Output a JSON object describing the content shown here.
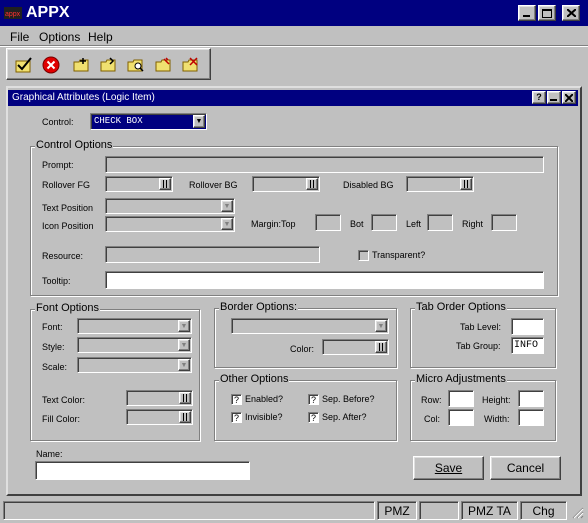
{
  "app": {
    "title": "APPX"
  },
  "menu": {
    "items": [
      "File",
      "Options",
      "Help"
    ]
  },
  "toolbar": {
    "icons": [
      "save-check",
      "cancel",
      "new-folder",
      "open-folder",
      "find-folder",
      "edit-folder",
      "delete-folder"
    ]
  },
  "dialog": {
    "title": "Graphical Attributes (Logic Item)",
    "control_label": "Control:",
    "control_value": "CHECK BOX",
    "control_options": {
      "legend": "Control Options",
      "prompt": "Prompt:",
      "rollover_fg": "Rollover FG",
      "rollover_bg": "Rollover BG",
      "disabled_bg": "Disabled BG",
      "text_position": "Text Position",
      "icon_position": "Icon Position",
      "margin_top": "Margin:Top",
      "bot": "Bot",
      "left": "Left",
      "right": "Right",
      "resource": "Resource:",
      "transparent": "Transparent?",
      "tooltip": "Tooltip:"
    },
    "font_options": {
      "legend": "Font Options",
      "font": "Font:",
      "style": "Style:",
      "scale": "Scale:",
      "text_color": "Text Color:",
      "fill_color": "Fill Color:"
    },
    "border_options": {
      "legend": "Border Options:",
      "color": "Color:"
    },
    "tab_order": {
      "legend": "Tab Order Options",
      "tab_level": "Tab Level:",
      "tab_group": "Tab Group:",
      "tab_group_value": "INFO"
    },
    "other_options": {
      "legend": "Other Options",
      "enabled": "Enabled?",
      "invisible": "Invisible?",
      "sep_before": "Sep. Before?",
      "sep_after": "Sep. After?"
    },
    "micro": {
      "legend": "Micro Adjustments",
      "row": "Row:",
      "height": "Height:",
      "col": "Col:",
      "width": "Width:"
    },
    "name_label": "Name:",
    "save": "Save",
    "cancel": "Cancel"
  },
  "status": {
    "cells": [
      "",
      "PMZ",
      "",
      "PMZ TA",
      "Chg"
    ]
  }
}
